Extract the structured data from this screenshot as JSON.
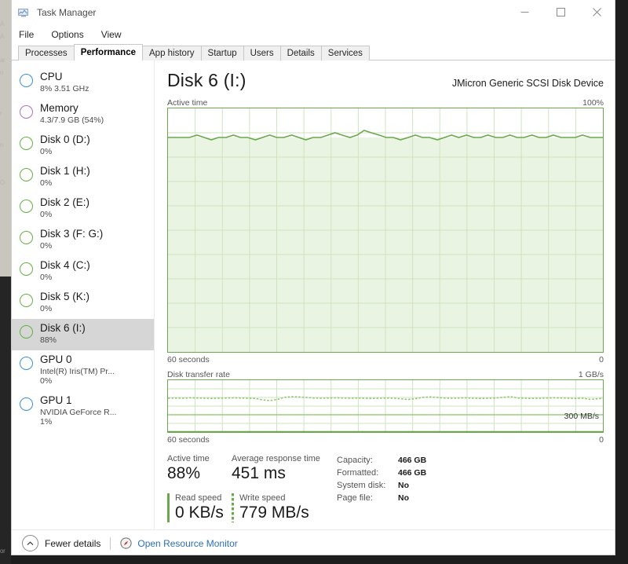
{
  "window": {
    "title": "Task Manager",
    "icon": "task-manager-icon",
    "controls": {
      "minimize": "–",
      "maximize": "□",
      "close": "✕"
    }
  },
  "menu": [
    "File",
    "Options",
    "View"
  ],
  "tabs": [
    {
      "label": "Processes",
      "active": false
    },
    {
      "label": "Performance",
      "active": true
    },
    {
      "label": "App history",
      "active": false
    },
    {
      "label": "Startup",
      "active": false
    },
    {
      "label": "Users",
      "active": false
    },
    {
      "label": "Details",
      "active": false
    },
    {
      "label": "Services",
      "active": false
    }
  ],
  "sidebar": {
    "items": [
      {
        "name": "CPU",
        "sub": "8% 3.51 GHz",
        "sub2": "",
        "ring": "cpu",
        "selected": false
      },
      {
        "name": "Memory",
        "sub": "4.3/7.9 GB (54%)",
        "sub2": "",
        "ring": "mem",
        "selected": false
      },
      {
        "name": "Disk 0 (D:)",
        "sub": "0%",
        "sub2": "",
        "ring": "disk",
        "selected": false
      },
      {
        "name": "Disk 1 (H:)",
        "sub": "0%",
        "sub2": "",
        "ring": "disk",
        "selected": false
      },
      {
        "name": "Disk 2 (E:)",
        "sub": "0%",
        "sub2": "",
        "ring": "disk",
        "selected": false
      },
      {
        "name": "Disk 3 (F: G:)",
        "sub": "0%",
        "sub2": "",
        "ring": "disk",
        "selected": false
      },
      {
        "name": "Disk 4 (C:)",
        "sub": "0%",
        "sub2": "",
        "ring": "disk",
        "selected": false
      },
      {
        "name": "Disk 5 (K:)",
        "sub": "0%",
        "sub2": "",
        "ring": "disk",
        "selected": false
      },
      {
        "name": "Disk 6 (I:)",
        "sub": "88%",
        "sub2": "",
        "ring": "disk",
        "selected": true
      },
      {
        "name": "GPU 0",
        "sub": "Intel(R) Iris(TM) Pr...",
        "sub2": "0%",
        "ring": "gpu",
        "selected": false
      },
      {
        "name": "GPU 1",
        "sub": "NVIDIA GeForce R...",
        "sub2": "1%",
        "ring": "gpu",
        "selected": false
      }
    ]
  },
  "main": {
    "title": "Disk 6 (I:)",
    "device": "JMicron Generic SCSI Disk Device",
    "graph1": {
      "label": "Active time",
      "max": "100%",
      "axis_left": "60 seconds",
      "axis_right": "0"
    },
    "graph2": {
      "label": "Disk transfer rate",
      "max": "1 GB/s",
      "mid_label": "300 MB/s",
      "axis_left": "60 seconds",
      "axis_right": "0"
    },
    "stats": {
      "active_time_label": "Active time",
      "active_time_value": "88%",
      "response_label": "Average response time",
      "response_value": "451 ms",
      "read_label": "Read speed",
      "read_value": "0 KB/s",
      "write_label": "Write speed",
      "write_value": "779 MB/s"
    },
    "info": [
      {
        "key": "Capacity:",
        "value": "466 GB"
      },
      {
        "key": "Formatted:",
        "value": "466 GB"
      },
      {
        "key": "System disk:",
        "value": "No"
      },
      {
        "key": "Page file:",
        "value": "No"
      }
    ]
  },
  "footer": {
    "fewer_details": "Fewer details",
    "resource_monitor": "Open Resource Monitor"
  },
  "colors": {
    "accent_green": "#6aa84f",
    "fill_green": "#eaf4e2",
    "link_blue": "#2b6fbb"
  },
  "chart_data": [
    {
      "type": "area",
      "title": "Active time",
      "ylabel": "%",
      "xlabel": "60 seconds",
      "ylim": [
        0,
        100
      ],
      "grid": true,
      "values": [
        88,
        88,
        88,
        88,
        89,
        88,
        87,
        88,
        88,
        89,
        88,
        88,
        87,
        88,
        89,
        88,
        88,
        89,
        88,
        87,
        88,
        88,
        89,
        90,
        89,
        88,
        89,
        91,
        90,
        89,
        88,
        88,
        87,
        88,
        89,
        88,
        88,
        87,
        88,
        89,
        88,
        89,
        88,
        88,
        89,
        88,
        88,
        89,
        88,
        88,
        89,
        88,
        88,
        89,
        88,
        88,
        88,
        89,
        88,
        88
      ]
    },
    {
      "type": "line",
      "title": "Disk transfer rate",
      "ylabel": "GB/s",
      "xlabel": "60 seconds",
      "ylim": [
        0,
        1000
      ],
      "grid": true,
      "annotations": [
        "300 MB/s"
      ],
      "series": [
        {
          "name": "Read speed",
          "values": [
            0,
            0,
            0,
            0,
            0,
            0,
            0,
            0,
            0,
            0,
            0,
            0,
            0,
            0,
            0,
            0,
            0,
            0,
            0,
            0,
            0,
            0,
            0,
            0,
            0,
            0,
            0,
            0,
            0,
            0,
            0,
            0,
            0,
            0,
            0,
            0,
            0,
            0,
            0,
            0,
            0,
            0,
            0,
            0,
            0,
            0,
            0,
            0,
            0,
            0,
            0,
            0,
            0,
            0,
            0,
            0,
            0,
            0,
            0,
            0
          ]
        },
        {
          "name": "Write speed",
          "values": [
            779,
            780,
            779,
            781,
            780,
            779,
            778,
            779,
            780,
            781,
            780,
            779,
            778,
            760,
            750,
            765,
            790,
            800,
            795,
            785,
            780,
            779,
            780,
            781,
            780,
            779,
            780,
            779,
            778,
            779,
            780,
            779,
            770,
            765,
            775,
            790,
            795,
            785,
            780,
            779,
            780,
            781,
            779,
            778,
            779,
            780,
            785,
            790,
            780,
            779,
            778,
            779,
            780,
            781,
            780,
            779,
            778,
            779,
            770,
            779
          ]
        }
      ]
    }
  ]
}
